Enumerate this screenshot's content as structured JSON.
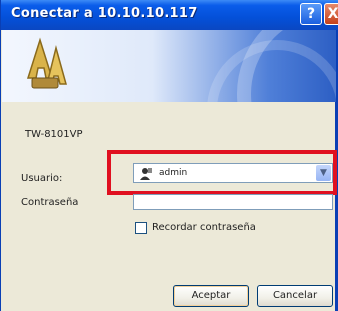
{
  "window": {
    "title": "Conectar a 10.10.10.117",
    "help_glyph": "?",
    "close_glyph": "X"
  },
  "dialog": {
    "server_name": "TW-8101VP",
    "user_label": "Usuario:",
    "user_value": "admin",
    "password_label": "Contraseña",
    "password_value": "",
    "remember_label": "Recordar contraseña",
    "remember_checked": false
  },
  "buttons": {
    "ok": "Aceptar",
    "cancel": "Cancelar"
  },
  "colors": {
    "titlebar": "#0450d8",
    "highlight": "#e01020",
    "dialog_bg": "#ece9d8"
  },
  "icons": {
    "banner": "keys-icon",
    "user": "user-icon",
    "dropdown": "chevron-down-icon"
  }
}
